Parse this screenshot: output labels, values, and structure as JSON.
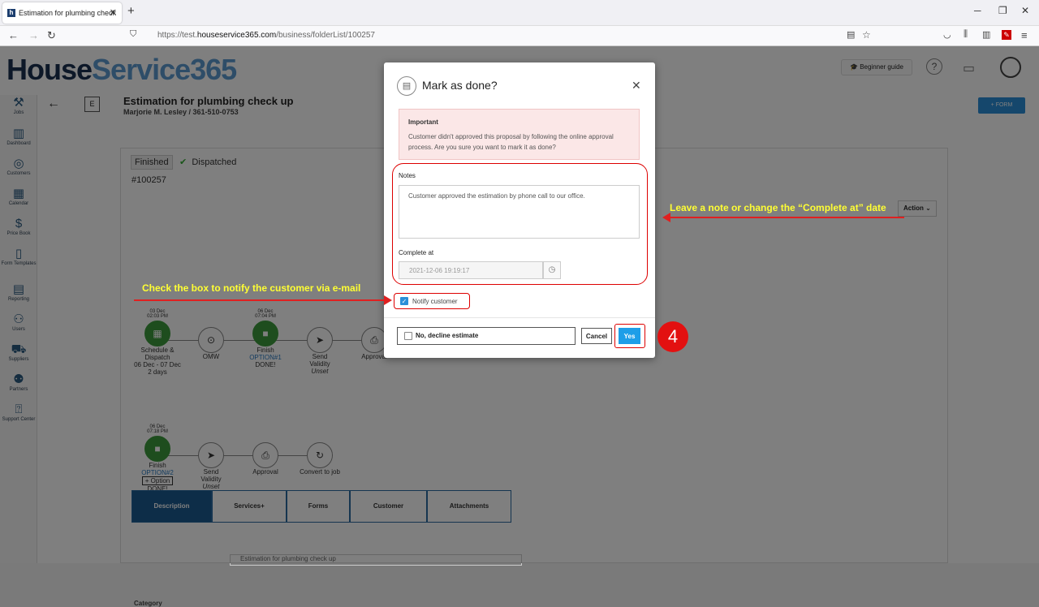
{
  "browser": {
    "tab_title": "Estimation for plumbing check",
    "url_prefix": "https://test.",
    "url_domain": "houseservice365.com",
    "url_path": "/business/folderList/100257"
  },
  "app": {
    "logo_house": "House",
    "logo_service": "Service365",
    "beginner_guide": "Beginner guide",
    "sidebar": [
      {
        "label": "Jobs"
      },
      {
        "label": "Dashboard"
      },
      {
        "label": "Customers"
      },
      {
        "label": "Calendar"
      },
      {
        "label": "Price Book"
      },
      {
        "label": "Form Templates"
      },
      {
        "label": "Reporting"
      },
      {
        "label": "Users"
      },
      {
        "label": "Suppliers"
      },
      {
        "label": "Partners"
      },
      {
        "label": "Support Center"
      }
    ],
    "job_badge": "E",
    "job_title": "Estimation for plumbing check up",
    "job_subtitle": "Marjorie M. Lesley / 361-510-0753",
    "form_button": "+ FORM",
    "status_finished": "Finished",
    "status_dispatched": "Dispatched",
    "job_number": "#100257",
    "action_button": "Action",
    "flow1": [
      {
        "top": "03 Dec",
        "time": "02:03 PM",
        "label": "Schedule & Dispatch",
        "sub": "06 Dec - 07 Dec",
        "sub2": "2 days"
      },
      {
        "label": "OMW"
      },
      {
        "top": "06 Dec",
        "time": "07:04 PM",
        "label": "Finish",
        "sub": "OPTION#1",
        "sub2": "DONE!"
      },
      {
        "label": "Send",
        "sub": "Validity",
        "sub2": "Unset"
      },
      {
        "label": "Approval"
      }
    ],
    "flow2": [
      {
        "top": "06 Dec",
        "time": "07:18 PM",
        "label": "Finish",
        "sub": "OPTION#2",
        "extra": "+ Option",
        "sub2": "DONE!"
      },
      {
        "label": "Send",
        "sub": "Validity",
        "sub2": "Unset"
      },
      {
        "label": "Approval"
      },
      {
        "label": "Convert to job"
      }
    ],
    "bottom_tabs": [
      "Description",
      "Services+",
      "Forms",
      "Customer",
      "Attachments"
    ],
    "category_label": "Category",
    "category_value": "Estimation for plumbing check up"
  },
  "modal": {
    "title": "Mark as done?",
    "important_title": "Important",
    "important_message": "Customer didn't approved this proposal by following the online approval process. Are you sure you want to mark it as done?",
    "notes_label": "Notes",
    "notes_value": "Customer approved the estimation by phone call to our office.",
    "complete_label": "Complete at",
    "complete_value": "2021-12-06 19:19:17",
    "notify_label": "Notify customer",
    "notify_checked": true,
    "decline_label": "No, decline estimate",
    "cancel_label": "Cancel",
    "yes_label": "Yes"
  },
  "annotations": {
    "note_callout": "Leave a note or change the “Complete at” date",
    "notify_callout": "Check the box to notify the customer via e-mail",
    "step_number": "4"
  },
  "colors": {
    "accent": "#1e9ee8",
    "highlight": "#e02020",
    "callout": "#ffff33",
    "brand_dark": "#1a3050",
    "brand_light": "#5c9bd1"
  }
}
